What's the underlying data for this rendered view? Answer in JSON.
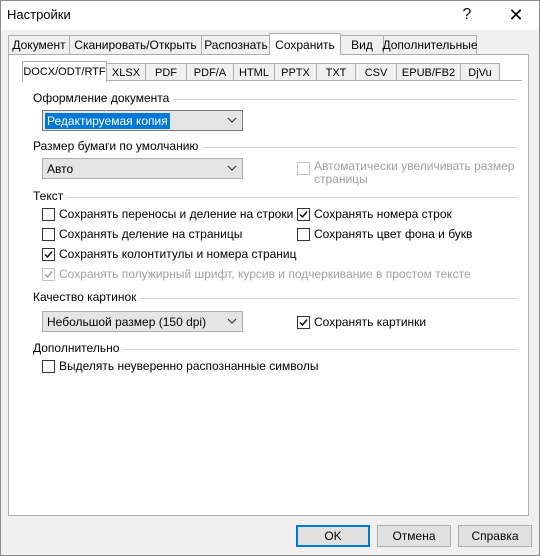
{
  "window": {
    "title": "Настройки",
    "help_glyph": "?",
    "close_glyph": "✕"
  },
  "tabs": [
    "Документ",
    "Сканировать/Открыть",
    "Распознать",
    "Сохранить",
    "Вид",
    "Дополнительные"
  ],
  "active_tab": "Сохранить",
  "subtabs": [
    "DOCX/ODT/RTF",
    "XLSX",
    "PDF",
    "PDF/A",
    "HTML",
    "PPTX",
    "TXT",
    "CSV",
    "EPUB/FB2",
    "DjVu"
  ],
  "active_subtab": "DOCX/ODT/RTF",
  "doc_format": {
    "label": "Оформление документа",
    "value": "Редактируемая копия"
  },
  "paper": {
    "label": "Размер бумаги по умолчанию",
    "value": "Авто",
    "auto_increase_line1": "Автоматически увеличивать размер",
    "auto_increase_line2": "страницы"
  },
  "text": {
    "label": "Текст",
    "keep_hyphens": "Сохранять переносы и деление на строки",
    "keep_line_numbers": "Сохранять номера строк",
    "keep_page_breaks": "Сохранять деление на страницы",
    "keep_bg_color": "Сохранять цвет фона и букв",
    "keep_headers": "Сохранять колонтитулы и номера страниц",
    "keep_bold": "Сохранять полужирный шрифт, курсив и подчеркивание в простом тексте"
  },
  "pictures": {
    "label": "Качество картинок",
    "value": "Небольшой размер (150 dpi)",
    "keep_pictures": "Сохранять картинки"
  },
  "extra": {
    "label": "Дополнительно",
    "highlight_uncertain": "Выделять неуверенно распознанные символы"
  },
  "buttons": {
    "ok": "OK",
    "cancel": "Отмена",
    "help": "Справка"
  },
  "checked": {
    "keep_hyphens": false,
    "keep_line_numbers": true,
    "keep_page_breaks": false,
    "keep_bg_color": false,
    "keep_headers": true,
    "keep_bold": true,
    "keep_pictures": true,
    "highlight_uncertain": false,
    "auto_increase": false
  }
}
